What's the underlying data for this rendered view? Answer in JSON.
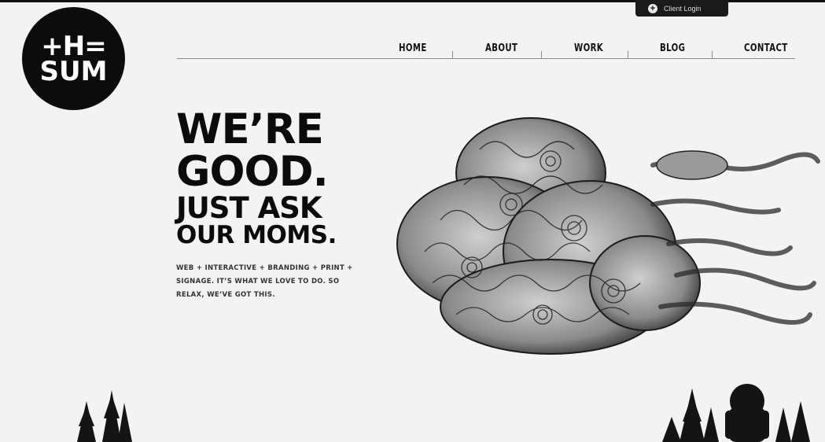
{
  "client_login": {
    "label": "Client Login",
    "icon": "plus-circle-icon"
  },
  "logo": {
    "line1": "+H=",
    "line2": "SUM"
  },
  "nav": [
    {
      "label": "HOME"
    },
    {
      "label": "ABOUT"
    },
    {
      "label": "WORK"
    },
    {
      "label": "BLOG"
    },
    {
      "label": "CONTACT"
    }
  ],
  "hero": {
    "line1": "WE’RE",
    "line2": "GOOD.",
    "line3": "JUST ASK",
    "line4": "OUR MOMS.",
    "tagline": "WEB + INTERACTIVE + BRANDING + PRINT + SIGNAGE. IT’S WHAT WE LOVE TO DO. SO RELAX, WE’VE GOT THIS."
  },
  "illustrations": [
    "swirling-cloud-illustration",
    "pine-trees-left",
    "pine-trees-right",
    "bigfoot-silhouette"
  ],
  "colors": {
    "background": "#f3f3f3",
    "text": "#0b0b0b",
    "dark_bar": "#1a1a1a"
  }
}
